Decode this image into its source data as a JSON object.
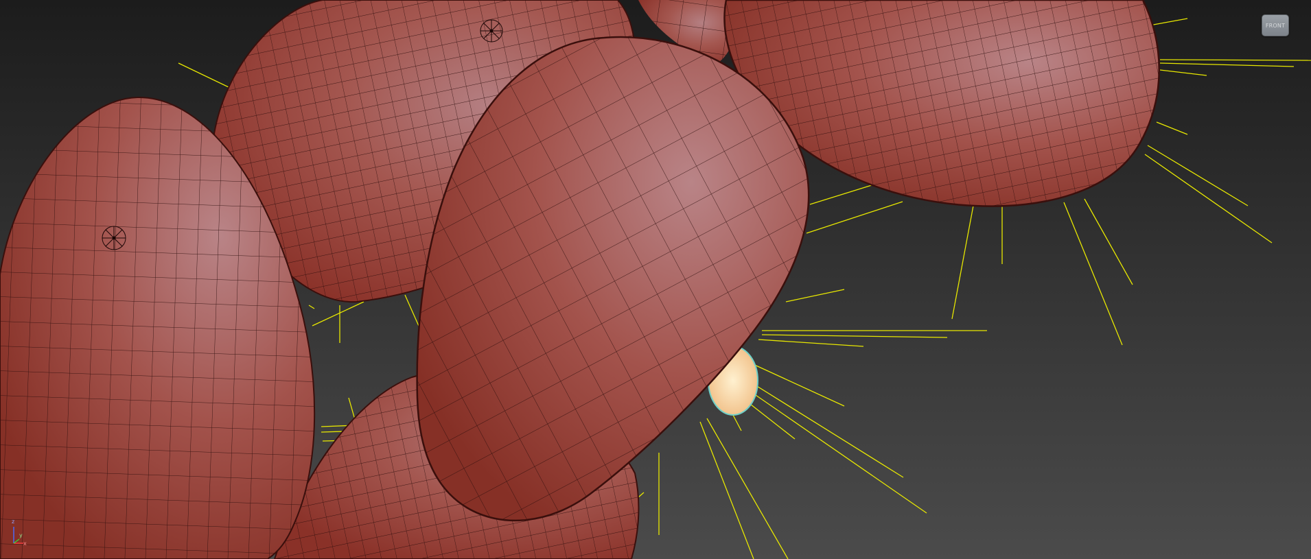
{
  "viewport": {
    "viewcube_label": "FRONT",
    "colors": {
      "background_top": "#1e1e1e",
      "background_bottom": "#4a4a4a",
      "mesh_fill": "#a4463e",
      "mesh_highlight": "#b97b7e",
      "wire": "#2b0d0c",
      "light_rays": "#e6e600",
      "glow": "#ffe0b0"
    },
    "axis": {
      "x": "x",
      "y": "y",
      "z": "z"
    },
    "icons": [
      "viewcube-icon",
      "axis-tripod-icon",
      "pivot-gizmo-icon"
    ]
  }
}
